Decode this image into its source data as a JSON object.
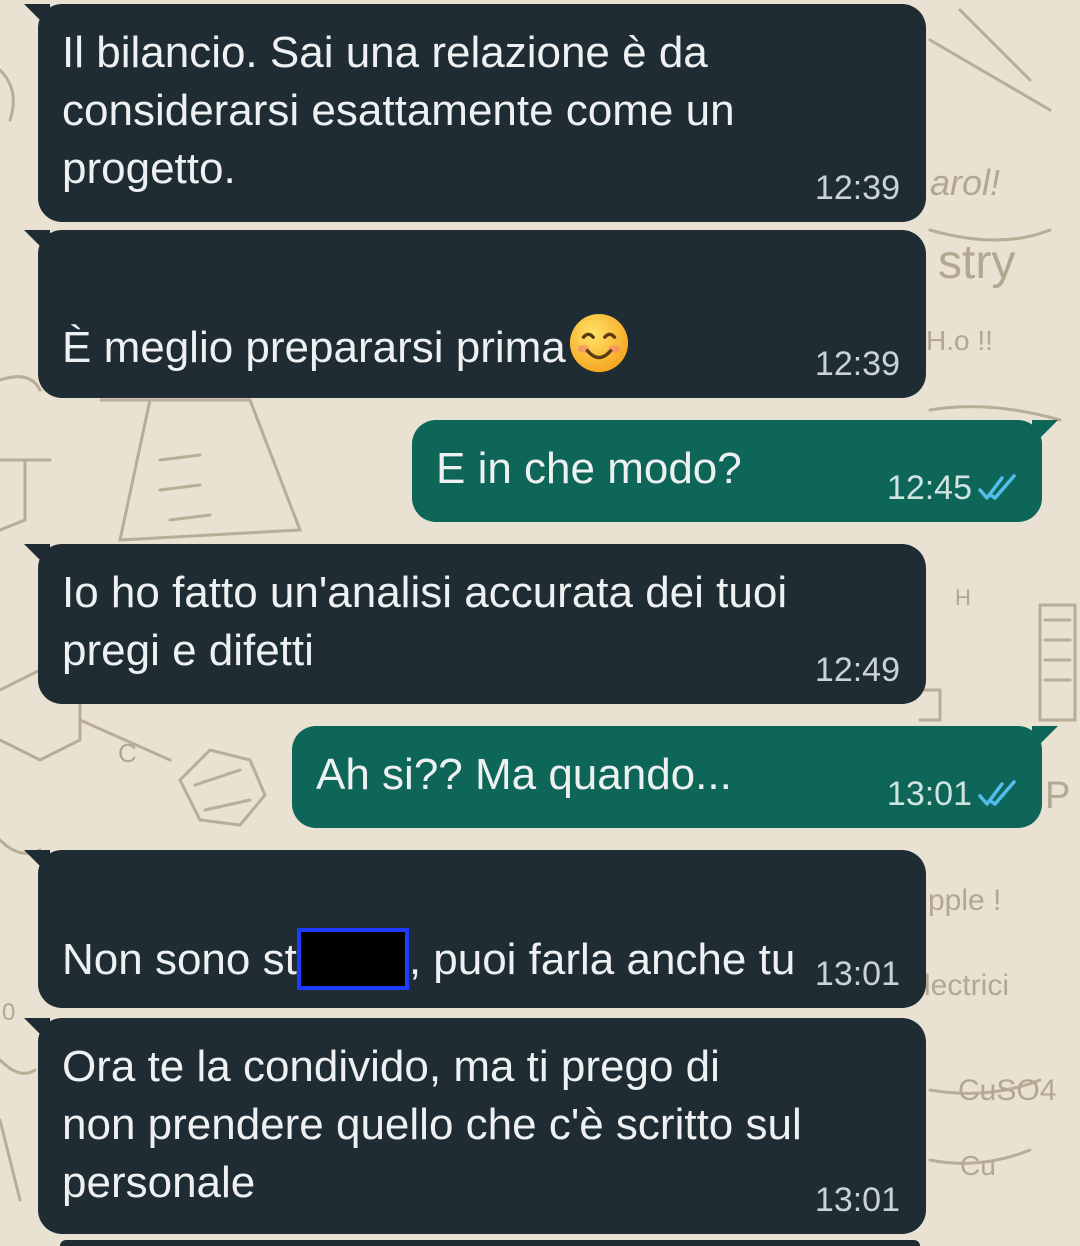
{
  "colors": {
    "incoming_bubble": "#1f2c33",
    "outgoing_bubble": "#0d6658",
    "wallpaper": "#e9e1d2",
    "read_ticks": "#53bdeb",
    "redaction_border": "#1d3cff"
  },
  "wallpaper_texts": {
    "t1": "arol!",
    "t2": "stry",
    "t3": "H.o !!",
    "t4": "pple !",
    "t5": "lectrici",
    "t6": "CuSO4",
    "t7": "Cu",
    "t8": "H",
    "t9": "C",
    "t10": "P",
    "t11": "0"
  },
  "messages": [
    {
      "direction": "incoming",
      "text": "Il bilancio.  Sai una relazione è da\nconsiderarsi esattamente come un\nprogetto.",
      "time": "12:39"
    },
    {
      "direction": "incoming",
      "text": "È meglio prepararsi prima",
      "emoji": "smiling-face-icon",
      "time": "12:39"
    },
    {
      "direction": "outgoing",
      "text": "E in che modo?",
      "time": "12:45",
      "status": "read"
    },
    {
      "direction": "incoming",
      "text": "Io ho fatto un'analisi accurata dei tuoi\npregi e difetti",
      "time": "12:49"
    },
    {
      "direction": "outgoing",
      "text": "Ah si?? Ma quando...",
      "time": "13:01",
      "status": "read"
    },
    {
      "direction": "incoming",
      "text_before": "Non sono st",
      "text_after": ", puoi farla anche tu",
      "redacted": true,
      "time": "13:01"
    },
    {
      "direction": "incoming",
      "text": "Ora te la condivido, ma ti prego di\nnon prendere quello che c'è scritto sul\npersonale",
      "time": "13:01"
    }
  ]
}
